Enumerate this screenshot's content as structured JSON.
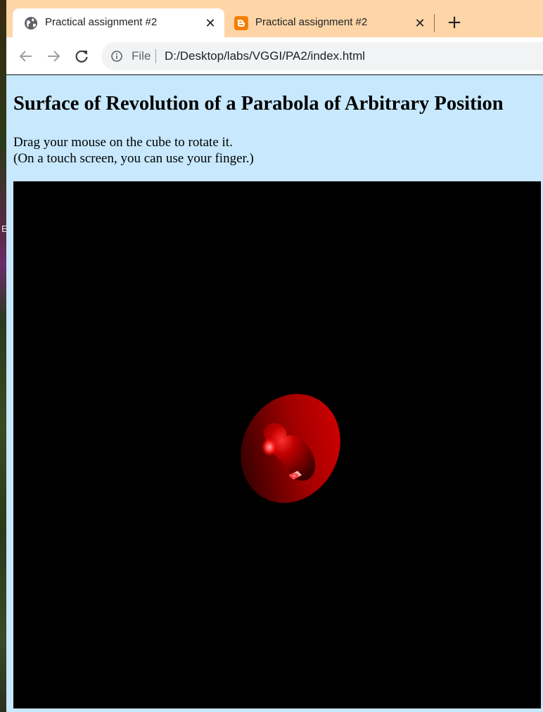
{
  "tabs": [
    {
      "title": "Practical assignment #2",
      "favicon": "globe-icon",
      "active": true
    },
    {
      "title": "Practical assignment #2",
      "favicon": "blogger-icon",
      "active": false
    }
  ],
  "address_bar": {
    "scheme_label": "File",
    "url": "D:/Desktop/labs/VGGI/PA2/index.html"
  },
  "page": {
    "heading": "Surface of Revolution of a Parabola of Arbitrary Position",
    "instruction_line1": "Drag your mouse on the cube to rotate it.",
    "instruction_line2": "(On a touch screen, you can use your finger.)"
  },
  "desktop": {
    "edge_letter": "E"
  },
  "colors": {
    "tabstrip_bg": "#fdd5a7",
    "page_bg": "#c7e8fd",
    "canvas_bg": "#000000",
    "surface_color": "#e00000",
    "blogger_orange": "#f57d00"
  }
}
